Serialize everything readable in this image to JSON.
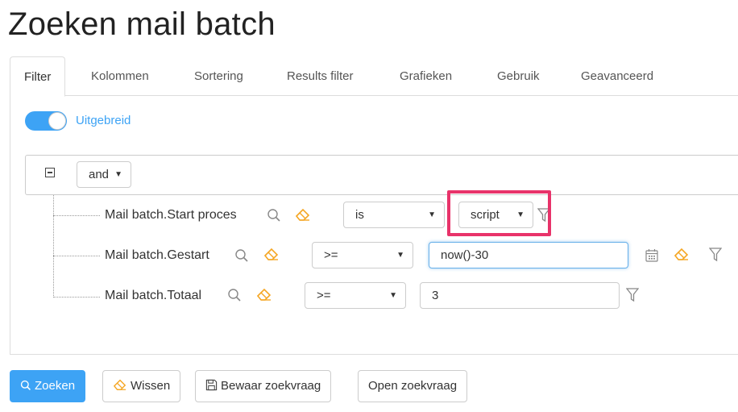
{
  "page": {
    "title": "Zoeken mail batch"
  },
  "tabs": [
    {
      "label": "Filter",
      "active": true
    },
    {
      "label": "Kolommen"
    },
    {
      "label": "Sortering"
    },
    {
      "label": "Results filter"
    },
    {
      "label": "Grafieken"
    },
    {
      "label": "Gebruik"
    },
    {
      "label": "Geavanceerd"
    }
  ],
  "toggle": {
    "label": "Uitgebreid",
    "on": true
  },
  "group": {
    "operator": "and"
  },
  "conditions": [
    {
      "field": "Mail batch.Start proces",
      "operator": "is",
      "value_type": "script"
    },
    {
      "field": "Mail batch.Gestart",
      "operator": ">=",
      "value": "now()-30"
    },
    {
      "field": "Mail batch.Totaal",
      "operator": ">=",
      "value": "3"
    }
  ],
  "buttons": {
    "search": "Zoeken",
    "clear": "Wissen",
    "save": "Bewaar zoekvraag",
    "open": "Open zoekvraag"
  },
  "colors": {
    "accent": "#3da3f5",
    "highlight": "#e8336a",
    "eraser": "#f5a623"
  }
}
